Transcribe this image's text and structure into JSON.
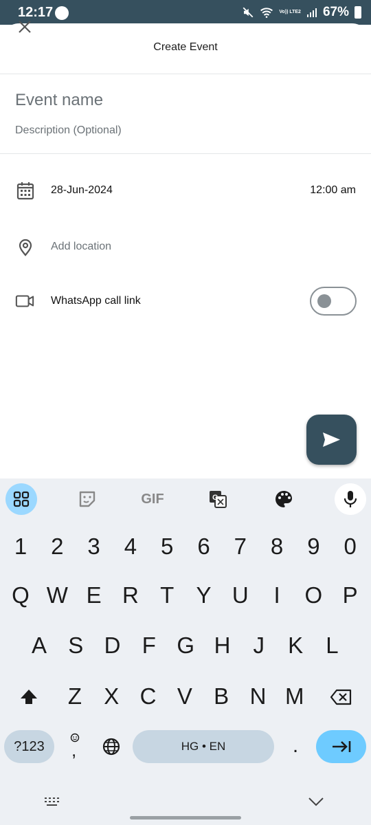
{
  "status_bar": {
    "time": "12:17",
    "network": "Vo)) LTE2",
    "battery": "67%"
  },
  "header": {
    "title": "Create Event"
  },
  "form": {
    "event_name_placeholder": "Event name",
    "description_placeholder": "Description (Optional)",
    "date": "28-Jun-2024",
    "time": "12:00 am",
    "location_placeholder": "Add location",
    "call_link_label": "WhatsApp call link",
    "call_link_enabled": false
  },
  "keyboard": {
    "toolbar": {
      "gif_label": "GIF"
    },
    "row_numbers": [
      "1",
      "2",
      "3",
      "4",
      "5",
      "6",
      "7",
      "8",
      "9",
      "0"
    ],
    "row1": [
      "Q",
      "W",
      "E",
      "R",
      "T",
      "Y",
      "U",
      "I",
      "O",
      "P"
    ],
    "row2": [
      "A",
      "S",
      "D",
      "F",
      "G",
      "H",
      "J",
      "K",
      "L"
    ],
    "row3": [
      "Z",
      "X",
      "C",
      "V",
      "B",
      "N",
      "M"
    ],
    "symbols_label": "?123",
    "comma_label": ",",
    "space_label": "HG • EN",
    "period_label": "."
  },
  "colors": {
    "accent": "#36505e",
    "keyboard_accent": "#6ecbff",
    "keyboard_bg": "#edf0f4"
  }
}
